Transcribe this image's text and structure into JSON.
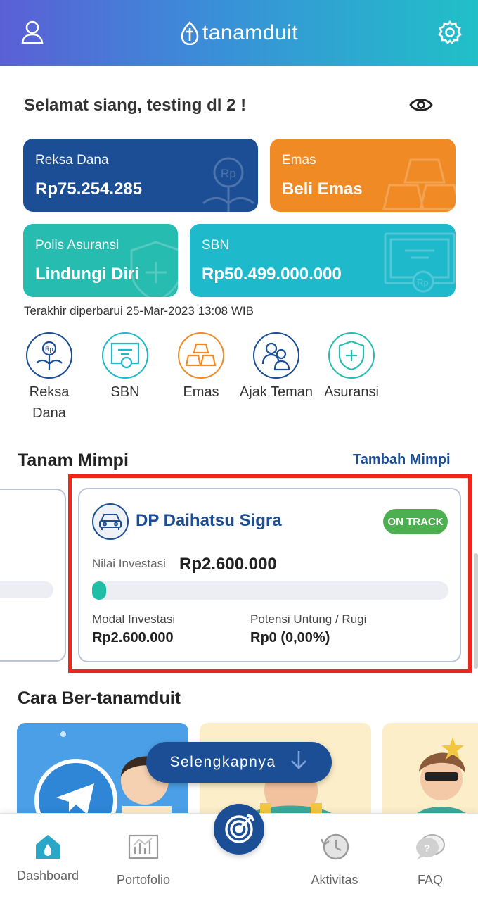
{
  "header": {
    "brand": "tanamduit",
    "brand_mark": "t",
    "profile_icon": "user-icon",
    "settings_icon": "gear-icon"
  },
  "greeting": {
    "text": "Selamat siang, testing dl 2 !",
    "toggle_icon": "eye-icon"
  },
  "summary": {
    "reksa_dana": {
      "label": "Reksa Dana",
      "value": "Rp75.254.285",
      "color": "#1c4e95"
    },
    "emas": {
      "label": "Emas",
      "value": "Beli Emas",
      "color": "#f08a24"
    },
    "polis_asuransi": {
      "label": "Polis Asuransi",
      "value": "Lindungi Diri",
      "color": "#27bcb0"
    },
    "sbn": {
      "label": "SBN",
      "value": "Rp50.499.000.000",
      "color": "#1fb9cc"
    },
    "updated": "Terakhir diperbarui 25-Mar-2023 13:08 WIB"
  },
  "quick_menu": [
    {
      "label": "Reksa Dana",
      "icon": "plant-coin-icon"
    },
    {
      "label": "SBN",
      "icon": "certificate-icon"
    },
    {
      "label": "Emas",
      "icon": "gold-bars-icon"
    },
    {
      "label": "Ajak Teman",
      "icon": "people-icon"
    },
    {
      "label": "Asuransi",
      "icon": "shield-plus-icon"
    }
  ],
  "tanam_mimpi": {
    "title": "Tanam Mimpi",
    "action": "Tambah Mimpi",
    "card": {
      "title": "DP Daihatsu Sigra",
      "icon": "car-icon",
      "status": "ON TRACK",
      "nilai_label": "Nilai Investasi",
      "nilai_value": "Rp2.600.000",
      "progress": 0.04,
      "modal_label": "Modal Investasi",
      "modal_value": "Rp2.600.000",
      "potensi_label": "Potensi Untung / Rugi",
      "potensi_value": "Rp0 (0,00%)"
    }
  },
  "cara": {
    "title": "Cara Ber-tanamduit",
    "more_label": "Selengkapnya"
  },
  "bottom_nav": [
    {
      "label": "Dashboard",
      "icon": "home-icon",
      "active": true
    },
    {
      "label": "Portofolio",
      "icon": "chart-icon"
    },
    {
      "label": "",
      "icon": "target-icon"
    },
    {
      "label": "Aktivitas",
      "icon": "history-icon"
    },
    {
      "label": "FAQ",
      "icon": "faq-icon"
    }
  ]
}
